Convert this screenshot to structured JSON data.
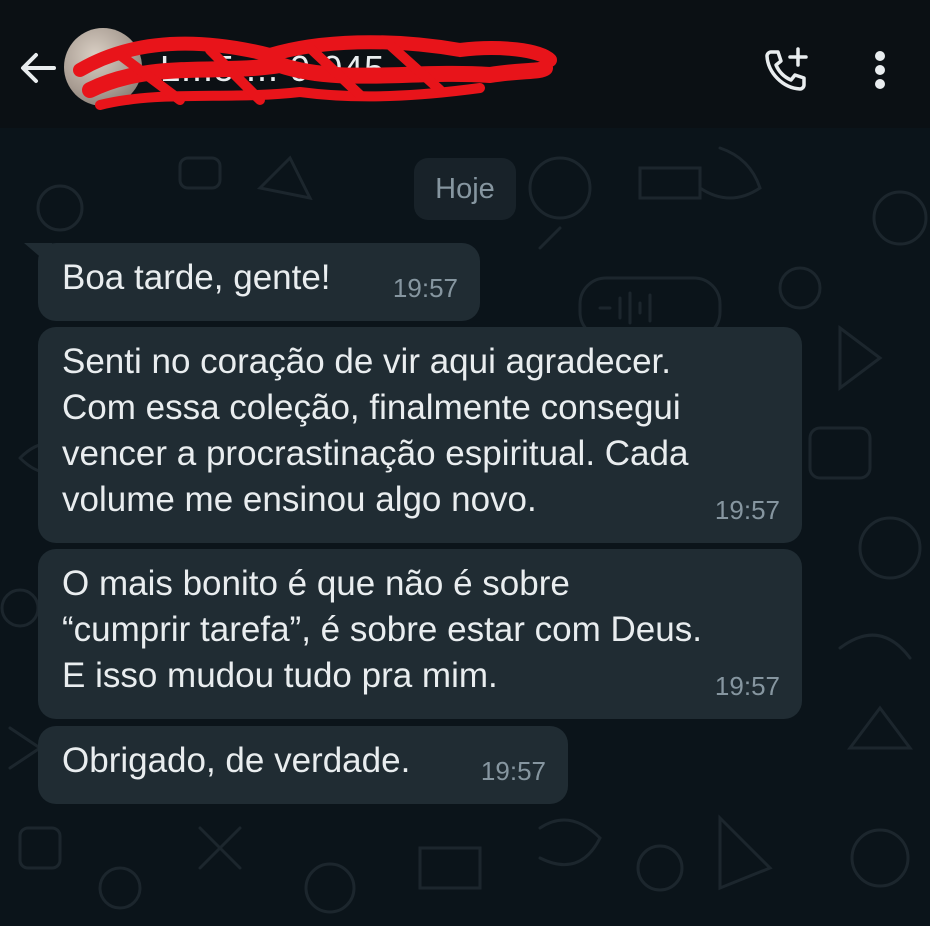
{
  "header": {
    "contact_name": "L...5 ... 9.045",
    "back_icon": "arrow-left-icon",
    "call_icon": "add-call-icon",
    "menu_icon": "more-vertical-icon"
  },
  "chat": {
    "date_label": "Hoje",
    "messages": [
      {
        "text": "Boa tarde, gente!",
        "time": "19:57"
      },
      {
        "text": "Senti no coração de vir aqui agradecer.\nCom essa coleção, finalmente consegui\nvencer a procrastinação espiritual. Cada\nvolume me ensinou algo novo.",
        "time": "19:57"
      },
      {
        "text": "O mais bonito é que não é sobre\n“cumprir tarefa”, é sobre estar com Deus.\nE isso mudou tudo pra mim.",
        "time": "19:57"
      },
      {
        "text": "Obrigado, de verdade.",
        "time": "19:57"
      }
    ]
  },
  "colors": {
    "background": "#0b141a",
    "header": "#0b1014",
    "bubble": "#202c33",
    "text": "#e9edef",
    "meta": "#8696a0",
    "redaction": "#e8141a"
  }
}
